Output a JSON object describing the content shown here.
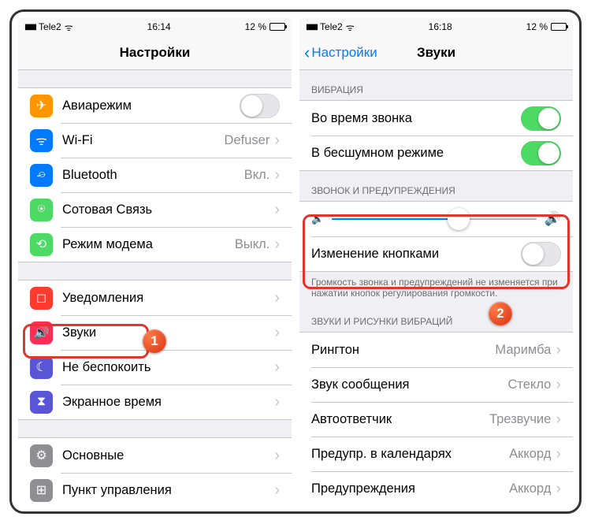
{
  "left": {
    "status": {
      "carrier": "Tele2",
      "time": "16:14",
      "battery": "12 %"
    },
    "title": "Настройки",
    "g1": [
      {
        "icon": "airplane-icon",
        "bg": "bg-orange",
        "glyph": "✈",
        "label": "Авиарежим",
        "toggle": false
      },
      {
        "icon": "wifi-icon",
        "bg": "bg-blue",
        "glyph": "ᯤ",
        "label": "Wi-Fi",
        "value": "Defuser"
      },
      {
        "icon": "bluetooth-icon",
        "bg": "bg-blue",
        "glyph": "⌮",
        "label": "Bluetooth",
        "value": "Вкл."
      },
      {
        "icon": "cellular-icon",
        "bg": "bg-green",
        "glyph": "⍟",
        "label": "Сотовая Связь",
        "value": ""
      },
      {
        "icon": "hotspot-icon",
        "bg": "bg-green",
        "glyph": "⟲",
        "label": "Режим модема",
        "value": "Выкл."
      }
    ],
    "g2": [
      {
        "icon": "notifications-icon",
        "bg": "bg-red",
        "glyph": "◻",
        "label": "Уведомления"
      },
      {
        "icon": "sounds-icon",
        "bg": "bg-pink",
        "glyph": "🔊",
        "label": "Звуки"
      },
      {
        "icon": "dnd-icon",
        "bg": "bg-purple",
        "glyph": "☾",
        "label": "Не беспокоить"
      },
      {
        "icon": "screentime-icon",
        "bg": "bg-purple",
        "glyph": "⧗",
        "label": "Экранное время"
      }
    ],
    "g3": [
      {
        "icon": "general-icon",
        "bg": "bg-gray",
        "glyph": "⚙",
        "label": "Основные"
      },
      {
        "icon": "control-center-icon",
        "bg": "bg-gray",
        "glyph": "⊞",
        "label": "Пункт управления"
      }
    ]
  },
  "right": {
    "status": {
      "carrier": "Tele2",
      "time": "16:18",
      "battery": "12 %"
    },
    "back": "Настройки",
    "title": "Звуки",
    "sec_vibration": "ВИБРАЦИЯ",
    "vib": [
      {
        "label": "Во время звонка",
        "on": true
      },
      {
        "label": "В бесшумном режиме",
        "on": true
      }
    ],
    "sec_ringer": "ЗВОНОК И ПРЕДУПРЕЖДЕНИЯ",
    "slider_percent": 62,
    "change_buttons": {
      "label": "Изменение кнопками",
      "on": false
    },
    "footer": "Громкость звонка и предупреждений не изменяется при нажатии кнопок регулирования громкости.",
    "sec_patterns": "ЗВУКИ И РИСУНКИ ВИБРАЦИЙ",
    "sounds": [
      {
        "label": "Рингтон",
        "value": "Маримба"
      },
      {
        "label": "Звук сообщения",
        "value": "Стекло"
      },
      {
        "label": "Автоответчик",
        "value": "Трезвучие"
      },
      {
        "label": "Предупр. в календарях",
        "value": "Аккорд"
      },
      {
        "label": "Предупреждения",
        "value": "Аккорд"
      }
    ]
  },
  "badges": {
    "b1": "1",
    "b2": "2"
  }
}
